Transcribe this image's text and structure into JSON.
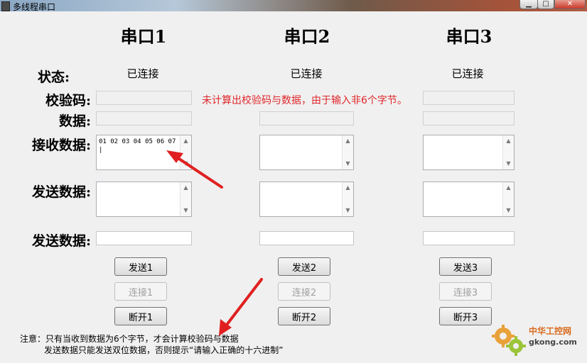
{
  "window": {
    "title": "多线程串口",
    "min_icon": "minimize-icon",
    "max_icon": "maximize-icon",
    "close_icon": "close-icon"
  },
  "ports": [
    {
      "title": "串口1",
      "status": "已连接",
      "receive_text": "01 02 03 04 05 06 07 |",
      "send_label": "发送1",
      "connect_label": "连接1",
      "disconnect_label": "断开1"
    },
    {
      "title": "串口2",
      "status": "已连接",
      "receive_text": "",
      "send_label": "发送2",
      "connect_label": "连接2",
      "disconnect_label": "断开2"
    },
    {
      "title": "串口3",
      "status": "已连接",
      "receive_text": "",
      "send_label": "发送3",
      "connect_label": "连接3",
      "disconnect_label": "断开3"
    }
  ],
  "labels": {
    "status": "状态:",
    "checksum": "校验码:",
    "data": "数据:",
    "receive": "接收数据:",
    "send_area": "发送数据:",
    "send_field": "发送数据:"
  },
  "error_message": "未计算出校验码与数据，由于输入非6个字节。",
  "notes": {
    "line1": "注意：只有当收到数据为6个字节，才会计算校验码与数据",
    "line2": "发送数据只能发送双位数据，否则提示“请输入正确的十六进制”"
  },
  "watermark": {
    "name": "中华工控网",
    "url": "gkong.com"
  },
  "colors": {
    "error": "#e0262a",
    "arrow": "#e02020"
  }
}
